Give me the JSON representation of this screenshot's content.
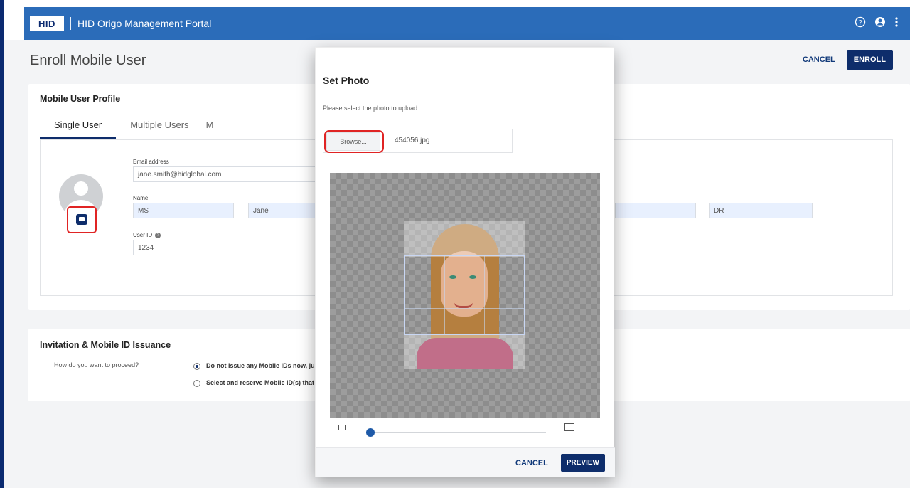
{
  "app": {
    "brand": "HID",
    "title": "HID Origo Management Portal",
    "icons": [
      "help-icon",
      "account-icon",
      "more-vert-icon"
    ]
  },
  "page": {
    "title": "Enroll Mobile User",
    "cancel_label": "CANCEL",
    "enroll_label": "ENROLL"
  },
  "profile": {
    "title": "Mobile User Profile",
    "tabs": [
      "Single User",
      "Multiple Users",
      "M"
    ],
    "email_label": "Email address",
    "email_value": "jane.smith@hidglobal.com",
    "name_label": "Name",
    "title_value": "MS",
    "first_value": "Jane",
    "suffix_value": "DR",
    "userid_label": "User ID",
    "userid_value": "1234"
  },
  "invitation": {
    "title": "Invitation & Mobile ID Issuance",
    "question": "How do you want to proceed?",
    "options": [
      {
        "label": "Do not issue any Mobile IDs now, jus",
        "selected": true
      },
      {
        "label": "Select and reserve Mobile ID(s) that",
        "selected": false
      }
    ]
  },
  "modal": {
    "title": "Set Photo",
    "subtitle": "Please select the photo to upload.",
    "browse_label": "Browse...",
    "file_name": "454056.jpg",
    "zoom_level": 0.02,
    "cancel_label": "CANCEL",
    "preview_label": "PREVIEW"
  },
  "colors": {
    "brand_navy": "#0e2d6b",
    "appbar_blue": "#2b6cb9",
    "highlight_red": "#e02424"
  }
}
